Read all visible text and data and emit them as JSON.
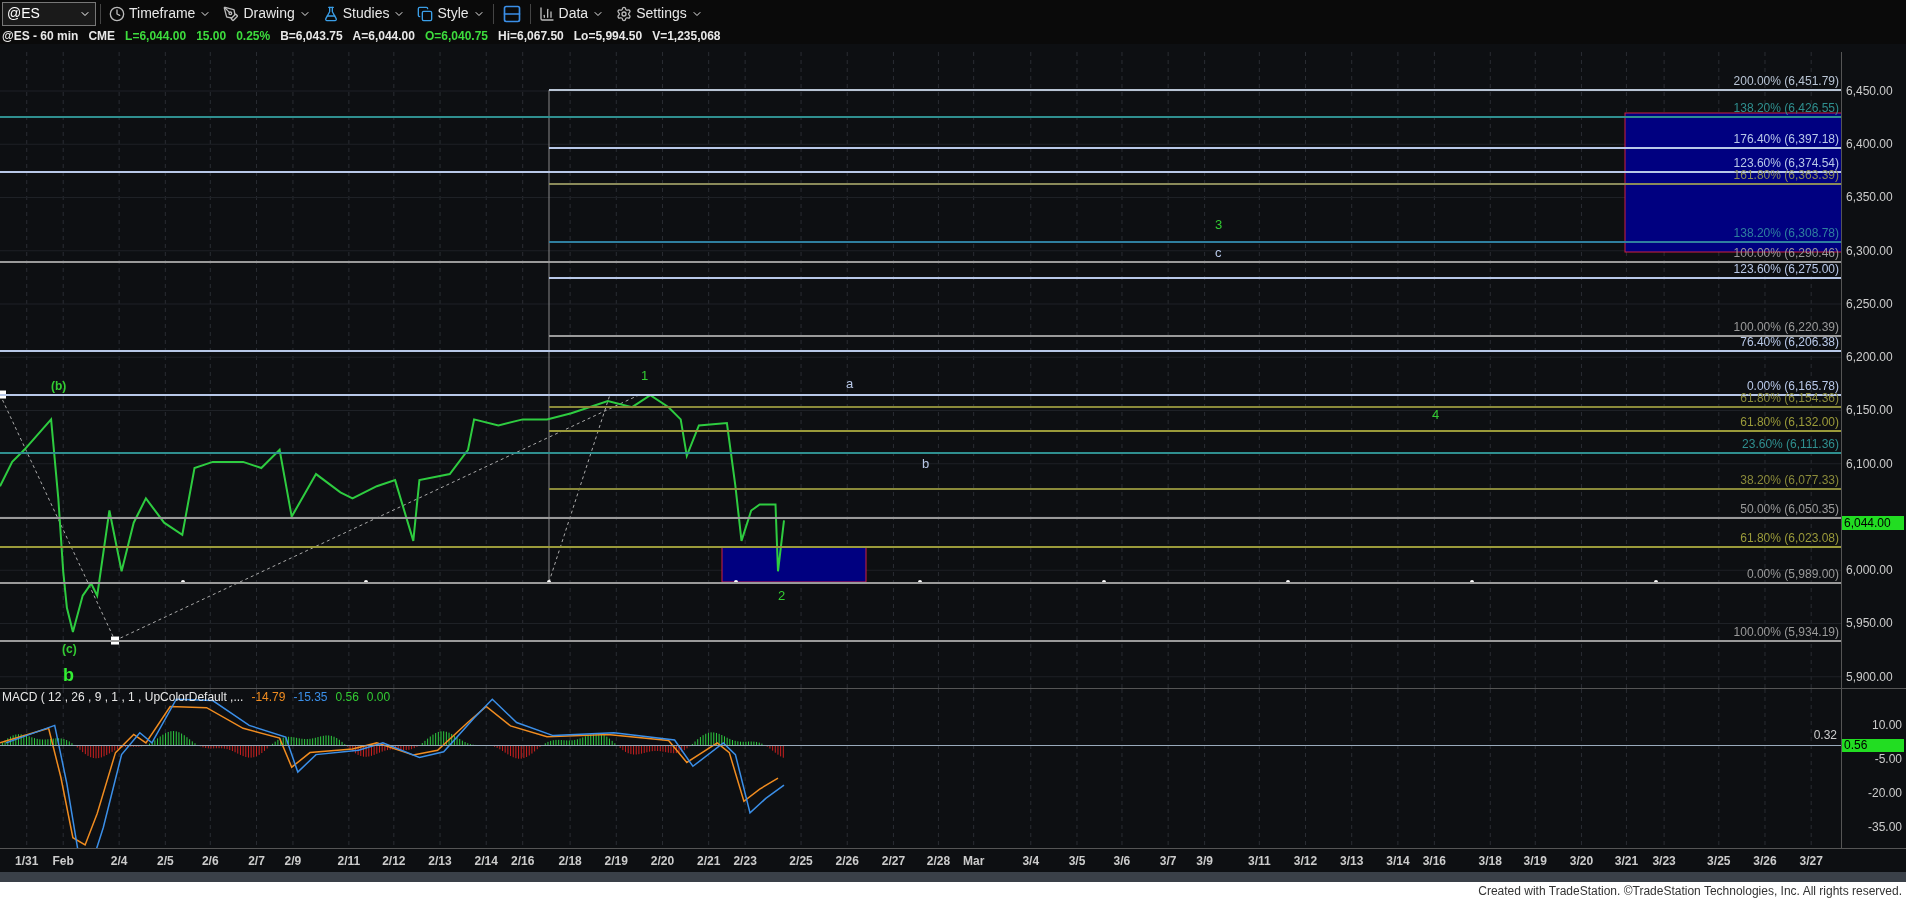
{
  "toolbar": {
    "symbol": "@ES",
    "buttons": [
      {
        "label": "Timeframe"
      },
      {
        "label": "Drawing"
      },
      {
        "label": "Studies"
      },
      {
        "label": "Style"
      },
      {
        "label": "Data"
      },
      {
        "label": "Settings"
      }
    ]
  },
  "info": [
    {
      "text": "@ES - 60 min",
      "color": "#e8e8e8"
    },
    {
      "text": "CME",
      "color": "#e8e8e8"
    },
    {
      "text": "L=6,044.00",
      "color": "#3ddc3d"
    },
    {
      "text": "15.00",
      "color": "#3ddc3d"
    },
    {
      "text": "0.25%",
      "color": "#3ddc3d"
    },
    {
      "text": "B=6,043.75",
      "color": "#e8e8e8"
    },
    {
      "text": "A=6,044.00",
      "color": "#e8e8e8"
    },
    {
      "text": "O=6,040.75",
      "color": "#3ddc3d"
    },
    {
      "text": "Hi=6,067.50",
      "color": "#e8e8e8"
    },
    {
      "text": "Lo=5,994.50",
      "color": "#e8e8e8"
    },
    {
      "text": "V=1,235,068",
      "color": "#e8e8e8"
    }
  ],
  "fib_levels": [
    {
      "label": "200.00% (6,451.79)",
      "color": "#b8c4d4"
    },
    {
      "label": "138.20% (6,426.55)",
      "color": "#2f8f8f"
    },
    {
      "label": "176.40% (6,397.18)",
      "color": "#b8c8e8"
    },
    {
      "label": "123.60% (6,374.54)",
      "color": "#b8c8e8"
    },
    {
      "label": "161.80% (6,363.39)",
      "color": "#8a8a5a"
    },
    {
      "label": "138.20% (6,308.78)",
      "color": "#2f7f9f"
    },
    {
      "label": "100.00% (6,290.46)",
      "color": "#9a9a9a"
    },
    {
      "label": "123.60% (6,275.00)",
      "color": "#b8c8e8"
    },
    {
      "label": "100.00% (6,220.39)",
      "color": "#9a9a9a"
    },
    {
      "label": "76.40% (6,206.38)",
      "color": "#b8c8e8"
    },
    {
      "label": "0.00% (6,165.78)",
      "color": "#b8c8e8"
    },
    {
      "label": "61.80% (6,154.36)",
      "color": "#8a8a3a"
    },
    {
      "label": "61.80% (6,132.00)",
      "color": "#9a9a3a"
    },
    {
      "label": "23.60% (6,111.36)",
      "color": "#2f8f8f"
    },
    {
      "label": "38.20% (6,077.33)",
      "color": "#8a8a3a"
    },
    {
      "label": "50.00% (6,050.35)",
      "color": "#9a9a9a"
    },
    {
      "label": "61.80% (6,023.08)",
      "color": "#9a9a3a"
    },
    {
      "label": "0.00% (5,989.00)",
      "color": "#9a9a9a"
    },
    {
      "label": "100.00% (5,934.19)",
      "color": "#9a9a9a"
    }
  ],
  "wave_labels": [
    {
      "text": "(b)",
      "color": "#33cc33"
    },
    {
      "text": "(c)",
      "color": "#33cc33"
    },
    {
      "text": "b",
      "color": "#33ee33"
    },
    {
      "text": "1",
      "color": "#33cc33"
    },
    {
      "text": "2",
      "color": "#33cc33"
    },
    {
      "text": "3",
      "color": "#33cc33"
    },
    {
      "text": "4",
      "color": "#33cc33"
    },
    {
      "text": "a",
      "color": "#b8c8e8"
    },
    {
      "text": "b",
      "color": "#b8c8e8"
    },
    {
      "text": "c",
      "color": "#b8c8e8"
    }
  ],
  "price_axis": {
    "ticks": [
      "6,450.00",
      "6,400.00",
      "6,350.00",
      "6,300.00",
      "6,250.00",
      "6,200.00",
      "6,150.00",
      "6,100.00",
      "6,000.00",
      "5,950.00",
      "5,900.00"
    ],
    "last_price": "6,044.00"
  },
  "macd": {
    "title": "MACD ( 12 , 26 , 9 , 1 , 1 , UpColorDefault ,...",
    "values": [
      {
        "text": "-14.79",
        "color": "#f08c20"
      },
      {
        "text": "-15.35",
        "color": "#3b8fe8"
      },
      {
        "text": "0.56",
        "color": "#33cc33"
      },
      {
        "text": "0.00",
        "color": "#33cc33"
      }
    ],
    "ticks": [
      "10.00",
      "-5.00",
      "-20.00",
      "-35.00"
    ],
    "line_label": "0.32",
    "badge": "0.56"
  },
  "dates": [
    "1/31",
    "Feb",
    "2/4",
    "2/5",
    "2/6",
    "2/7",
    "2/9",
    "2/11",
    "2/12",
    "2/13",
    "2/14",
    "2/16",
    "2/18",
    "2/19",
    "2/20",
    "2/21",
    "2/23",
    "2/25",
    "2/26",
    "2/27",
    "2/28",
    "Mar",
    "3/4",
    "3/5",
    "3/6",
    "3/7",
    "3/9",
    "3/11",
    "3/12",
    "3/13",
    "3/14",
    "3/16",
    "3/18",
    "3/19",
    "3/20",
    "3/21",
    "3/23",
    "3/25",
    "3/26",
    "3/27"
  ],
  "footer": "Created with TradeStation. ©TradeStation Technologies, Inc. All rights reserved."
}
